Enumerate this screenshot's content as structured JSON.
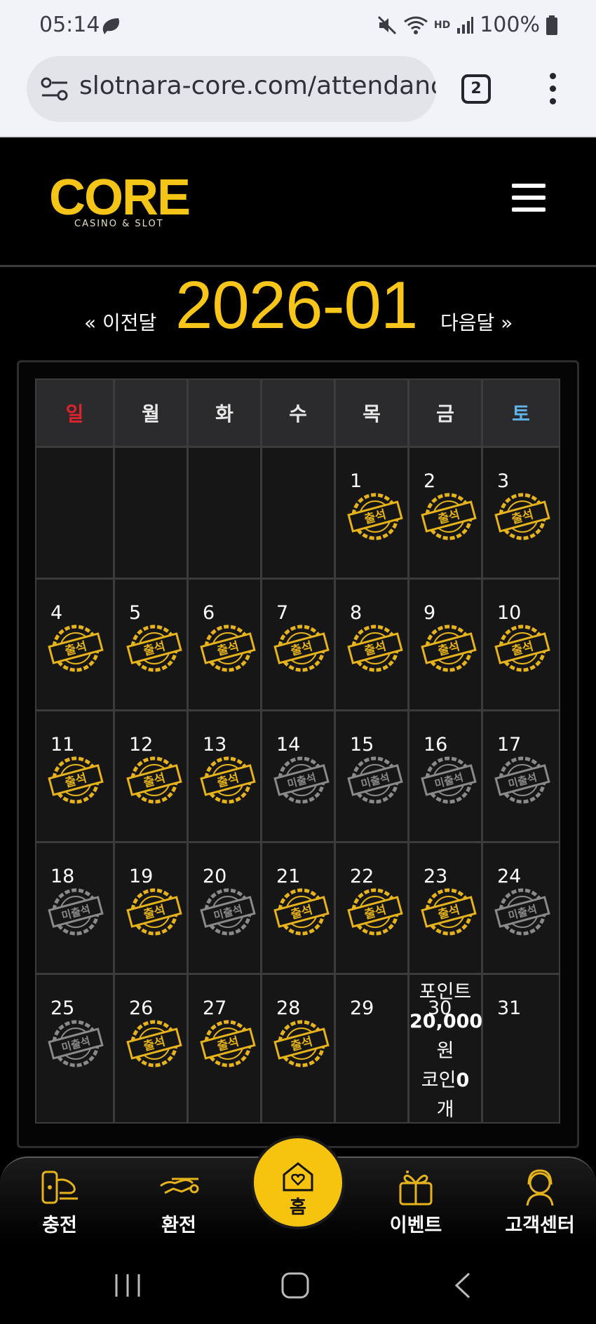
{
  "status_bar": {
    "time": "05:14",
    "battery": "100%",
    "hd_voice": "HD"
  },
  "browser": {
    "url": "slotnara-core.com/attendanc",
    "tab_count": "2"
  },
  "logo": {
    "text": "CORE",
    "subtitle": "CASINO & SLOT"
  },
  "calendar_nav": {
    "prev": "« 이전달",
    "month": "2026-01",
    "next": "다음달 »"
  },
  "weekdays": [
    "일",
    "월",
    "화",
    "수",
    "목",
    "금",
    "토"
  ],
  "weeks": [
    [
      {
        "day": ""
      },
      {
        "day": ""
      },
      {
        "day": ""
      },
      {
        "day": ""
      },
      {
        "day": "1",
        "stamp": "출석"
      },
      {
        "day": "2",
        "stamp": "출석"
      },
      {
        "day": "3",
        "stamp": "출석"
      }
    ],
    [
      {
        "day": "4",
        "stamp": "출석"
      },
      {
        "day": "5",
        "stamp": "출석"
      },
      {
        "day": "6",
        "stamp": "출석"
      },
      {
        "day": "7",
        "stamp": "출석"
      },
      {
        "day": "8",
        "stamp": "출석"
      },
      {
        "day": "9",
        "stamp": "출석"
      },
      {
        "day": "10",
        "stamp": "출석"
      }
    ],
    [
      {
        "day": "11",
        "stamp": "출석"
      },
      {
        "day": "12",
        "stamp": "출석"
      },
      {
        "day": "13",
        "stamp": "출석"
      },
      {
        "day": "14",
        "stamp": "미출석"
      },
      {
        "day": "15",
        "stamp": "미출석"
      },
      {
        "day": "16",
        "stamp": "미출석"
      },
      {
        "day": "17",
        "stamp": "미출석"
      }
    ],
    [
      {
        "day": "18",
        "stamp": "미출석"
      },
      {
        "day": "19",
        "stamp": "출석"
      },
      {
        "day": "20",
        "stamp": "미출석"
      },
      {
        "day": "21",
        "stamp": "출석"
      },
      {
        "day": "22",
        "stamp": "출석"
      },
      {
        "day": "23",
        "stamp": "출석"
      },
      {
        "day": "24",
        "stamp": "미출석"
      }
    ],
    [
      {
        "day": "25",
        "stamp": "미출석"
      },
      {
        "day": "26",
        "stamp": "출석"
      },
      {
        "day": "27",
        "stamp": "출석"
      },
      {
        "day": "28",
        "stamp": "출석"
      },
      {
        "day": "29"
      },
      {
        "day": "30",
        "points": {
          "l1": "포인트",
          "l2": "20,000",
          "l3": "원",
          "l4a": "코인",
          "l4b": "0",
          "l5": "개"
        }
      },
      {
        "day": "31"
      }
    ]
  ],
  "colors": {
    "accent": "#f7c619",
    "attended": "#e6b31a",
    "absent": "#8a8a8a",
    "sunday": "#e0232b",
    "saturday": "#5fb3e6"
  },
  "bottom_nav": {
    "charge": "충전",
    "exchange": "환전",
    "home": "홈",
    "event": "이벤트",
    "support": "고객센터"
  }
}
